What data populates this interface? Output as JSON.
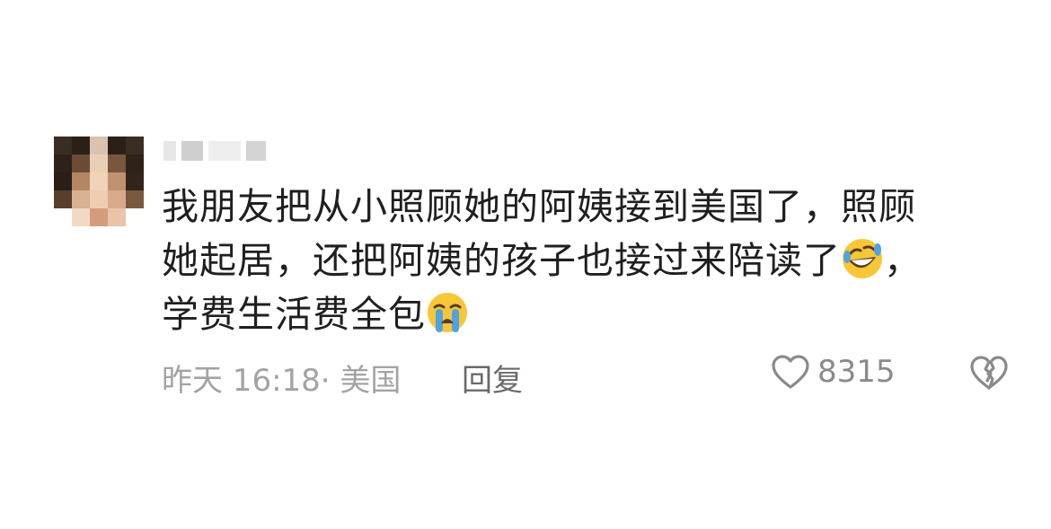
{
  "comment": {
    "avatar": "blurred-avatar",
    "username": "",
    "text_line1": "我朋友把从小照顾她的阿姨接到美国了，照顾",
    "text_line2": "她起居，还把阿姨的孩子也接过来陪读了",
    "text_line2_after": "，",
    "text_line3": "学费生活费全包",
    "emoji_1": "rolling-on-floor-laughing-emoji",
    "emoji_2": "loudly-crying-emoji",
    "timestamp": "昨天 16:18· 美国",
    "reply_label": "回复",
    "like_count": "8315",
    "like_icon": "heart-outline-icon",
    "dislike_icon": "broken-heart-icon"
  },
  "colors": {
    "text": "#1f1f1f",
    "meta": "#a3a3a3",
    "reply": "#6a6a6a",
    "icon": "#8a8a8a"
  }
}
